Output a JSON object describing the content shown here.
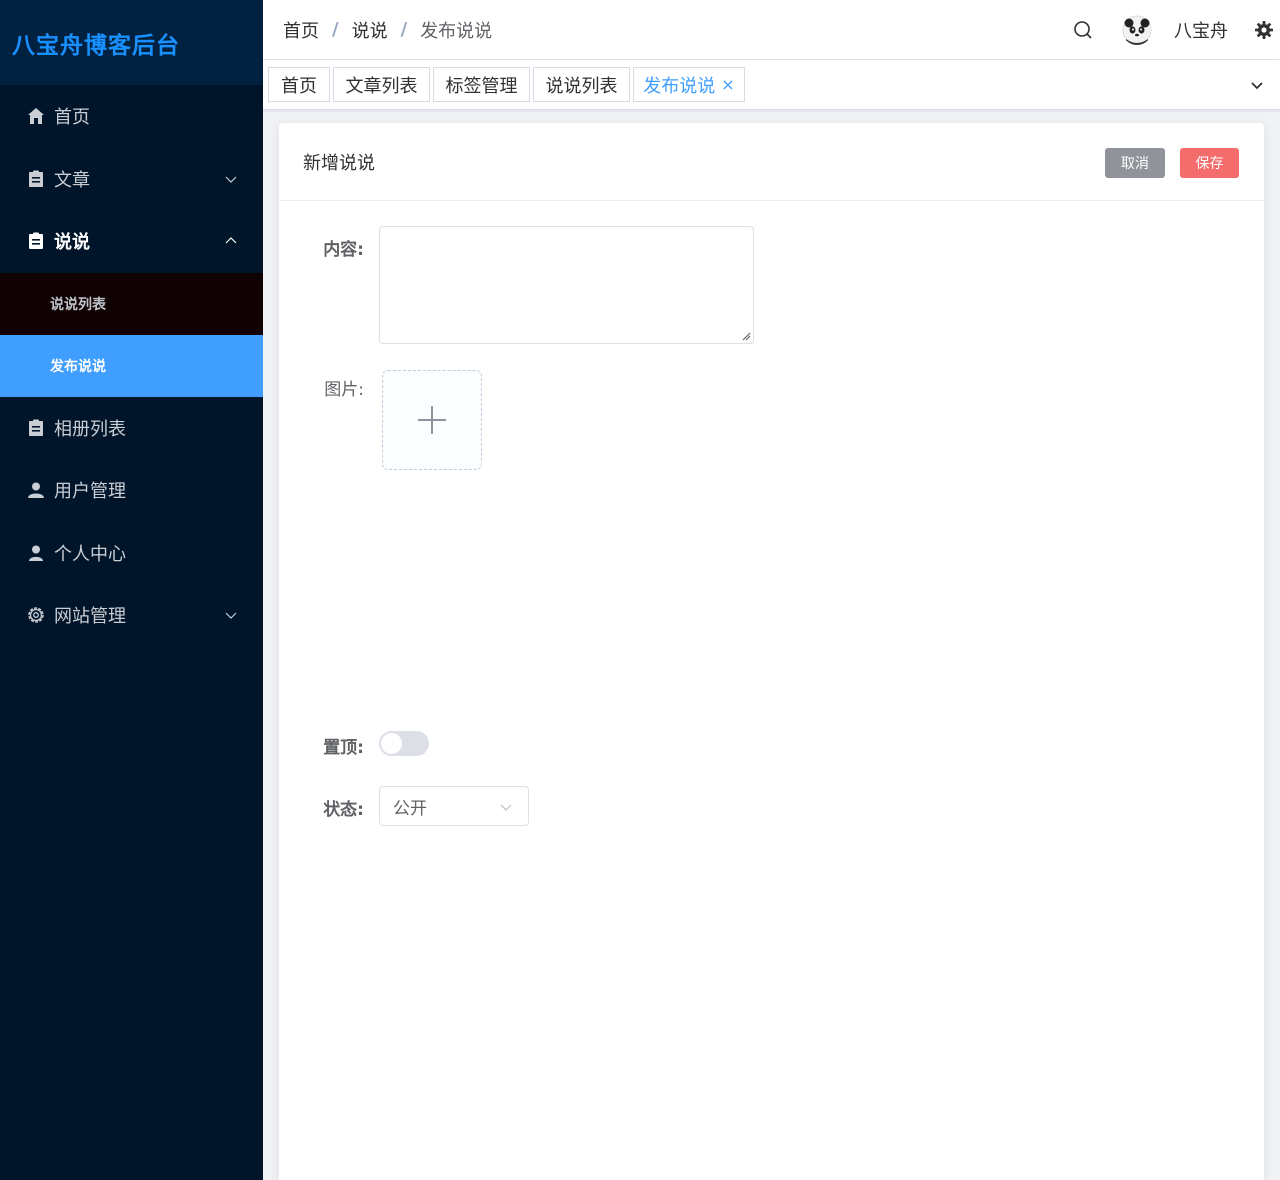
{
  "app": {
    "title": "八宝舟博客后台"
  },
  "sidebar": {
    "items": [
      {
        "label": "首页",
        "icon": "home-icon"
      },
      {
        "label": "文章",
        "icon": "document-icon"
      },
      {
        "label": "说说",
        "icon": "document-icon"
      },
      {
        "label": "相册列表",
        "icon": "document-icon"
      },
      {
        "label": "用户管理",
        "icon": "user-icon"
      },
      {
        "label": "个人中心",
        "icon": "user-icon"
      },
      {
        "label": "网站管理",
        "icon": "gear-icon"
      }
    ],
    "submenu": [
      {
        "label": "说说列表"
      },
      {
        "label": "发布说说"
      }
    ]
  },
  "header": {
    "breadcrumb": [
      "首页",
      "说说",
      "发布说说"
    ],
    "separator": "/",
    "username": "八宝舟"
  },
  "tags": [
    {
      "label": "首页"
    },
    {
      "label": "文章列表"
    },
    {
      "label": "标签管理"
    },
    {
      "label": "说说列表"
    },
    {
      "label": "发布说说",
      "close": "×"
    }
  ],
  "main": {
    "title": "新增说说",
    "cancel_label": "取消",
    "save_label": "保存",
    "form": {
      "content_label": "内容:",
      "content_value": "",
      "image_label": "图片:",
      "pin_label": "置顶:",
      "pin_on": false,
      "status_label": "状态:",
      "status_value": "公开"
    }
  },
  "colors": {
    "sidebar_bg": "#001529",
    "logo_color": "#1890ff",
    "active_menu": "#409eff",
    "cancel_btn": "#909399",
    "save_btn": "#f56c6c"
  }
}
